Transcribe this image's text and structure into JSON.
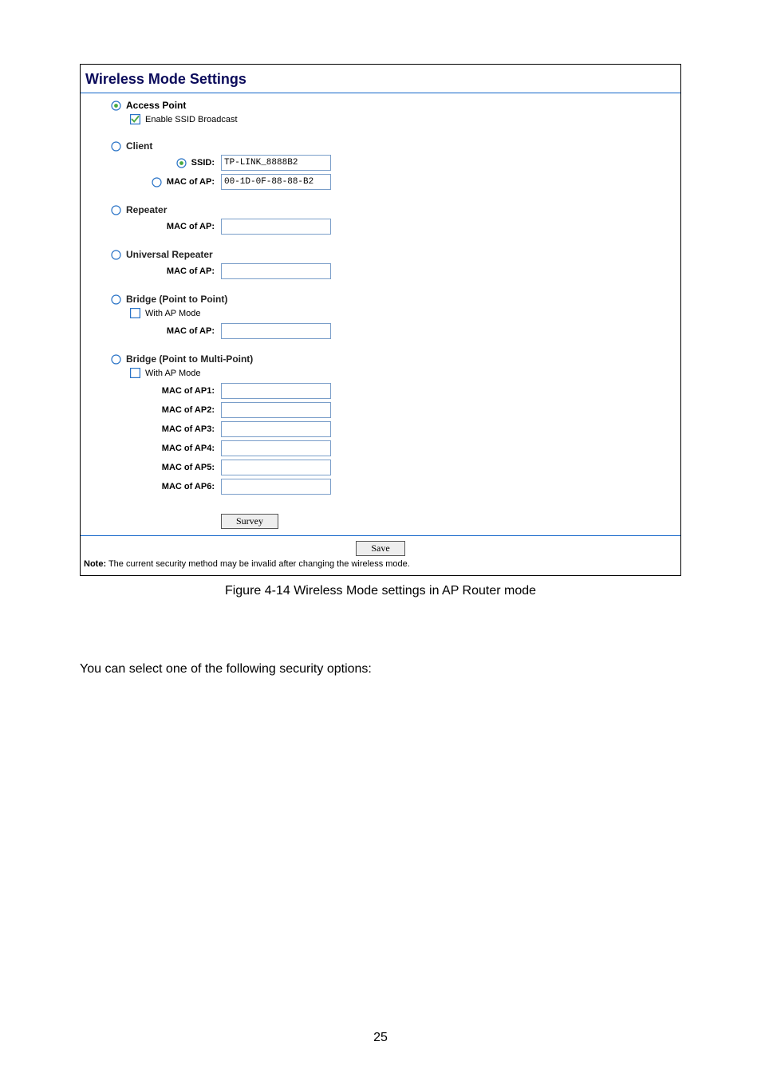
{
  "panel": {
    "title": "Wireless Mode Settings",
    "modes": {
      "access_point": {
        "label": "Access Point",
        "enable_ssid_broadcast": {
          "label": "Enable SSID Broadcast",
          "checked": true
        }
      },
      "client": {
        "label": "Client",
        "ssid": {
          "label": "SSID:",
          "value": "TP-LINK_8888B2"
        },
        "mac": {
          "label": "MAC of AP:",
          "value": "00-1D-0F-88-88-B2"
        }
      },
      "repeater": {
        "label": "Repeater",
        "mac": {
          "label": "MAC of AP:",
          "value": ""
        }
      },
      "universal_repeater": {
        "label": "Universal Repeater",
        "mac": {
          "label": "MAC of AP:",
          "value": ""
        }
      },
      "bridge_p2p": {
        "label": "Bridge (Point to Point)",
        "with_ap_mode": {
          "label": "With AP Mode",
          "checked": false
        },
        "mac": {
          "label": "MAC of AP:",
          "value": ""
        }
      },
      "bridge_p2mp": {
        "label": "Bridge (Point to Multi-Point)",
        "with_ap_mode": {
          "label": "With AP Mode",
          "checked": false
        },
        "macs": {
          "ap1": {
            "label": "MAC of AP1:",
            "value": ""
          },
          "ap2": {
            "label": "MAC of AP2:",
            "value": ""
          },
          "ap3": {
            "label": "MAC of AP3:",
            "value": ""
          },
          "ap4": {
            "label": "MAC of AP4:",
            "value": ""
          },
          "ap5": {
            "label": "MAC of AP5:",
            "value": ""
          },
          "ap6": {
            "label": "MAC of AP6:",
            "value": ""
          }
        }
      }
    },
    "buttons": {
      "survey": "Survey",
      "save": "Save"
    },
    "note": {
      "prefix": "Note:",
      "text": " The current security method may be invalid after changing the wireless mode."
    }
  },
  "caption": "Figure 4-14 Wireless Mode settings in AP Router mode",
  "body_text": "You can select one of the following security options:",
  "page_number": "25"
}
